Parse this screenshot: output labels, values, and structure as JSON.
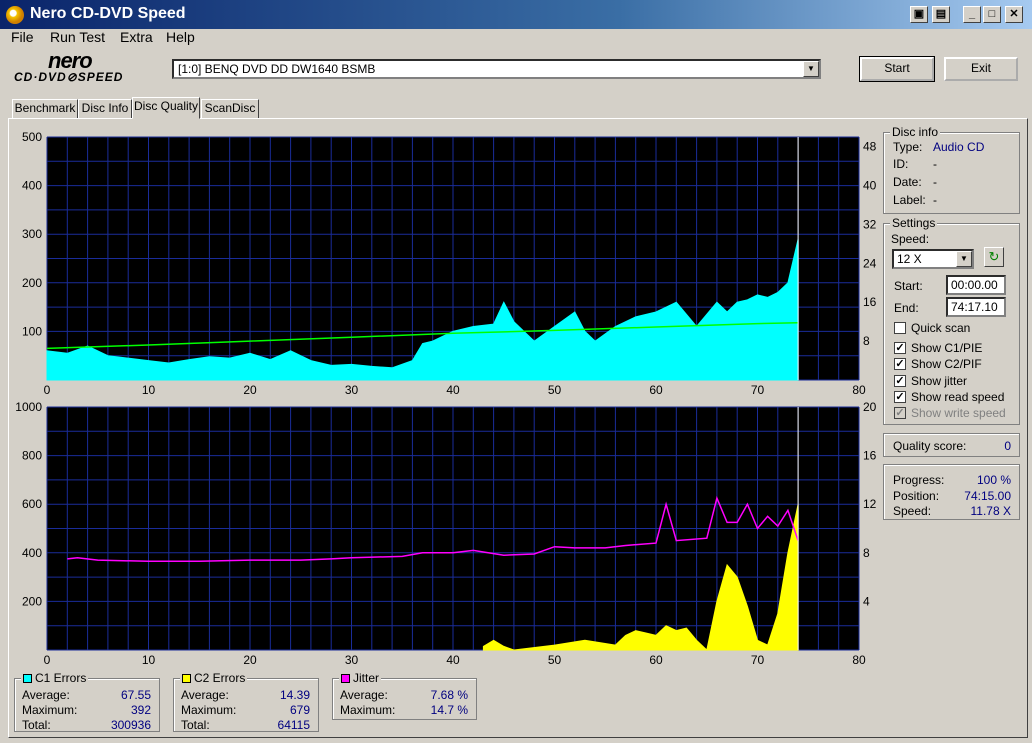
{
  "window": {
    "title": "Nero CD-DVD Speed"
  },
  "menu": {
    "file": "File",
    "run_test": "Run Test",
    "extra": "Extra",
    "help": "Help"
  },
  "logo": {
    "brand": "nero",
    "product": "CD·DVD⊘SPEED"
  },
  "drive": {
    "selected": "[1:0]  BENQ DVD DD DW1640 BSMB"
  },
  "buttons": {
    "start": "Start",
    "exit": "Exit"
  },
  "tabs": [
    "Benchmark",
    "Disc Info",
    "Disc Quality",
    "ScanDisc"
  ],
  "active_tab": "Disc Quality",
  "disc_info": {
    "title": "Disc info",
    "type_label": "Type:",
    "type_value": "Audio CD",
    "id_label": "ID:",
    "id_value": "-",
    "date_label": "Date:",
    "date_value": "-",
    "label_label": "Label:",
    "label_value": "-"
  },
  "settings": {
    "title": "Settings",
    "speed_label": "Speed:",
    "speed_value": "12 X",
    "start_label": "Start:",
    "start_value": "00:00.00",
    "end_label": "End:",
    "end_value": "74:17.10",
    "quick_scan": "Quick scan",
    "quick_scan_checked": false,
    "show_c1": "Show C1/PIE",
    "show_c1_checked": true,
    "show_c2": "Show C2/PIF",
    "show_c2_checked": true,
    "show_jitter": "Show jitter",
    "show_jitter_checked": true,
    "show_read": "Show read speed",
    "show_read_checked": true,
    "show_write": "Show write speed",
    "show_write_checked": true
  },
  "quality": {
    "label": "Quality score:",
    "value": "0"
  },
  "progress": {
    "progress_label": "Progress:",
    "progress_value": "100 %",
    "position_label": "Position:",
    "position_value": "74:15.00",
    "speed_label": "Speed:",
    "speed_value": "11.78 X"
  },
  "stats": {
    "c1": {
      "title": "C1 Errors",
      "color": "#00ffff",
      "avg_label": "Average:",
      "avg": "67.55",
      "max_label": "Maximum:",
      "max": "392",
      "total_label": "Total:",
      "total": "300936"
    },
    "c2": {
      "title": "C2 Errors",
      "color": "#ffff00",
      "avg_label": "Average:",
      "avg": "14.39",
      "max_label": "Maximum:",
      "max": "679",
      "total_label": "Total:",
      "total": "64115"
    },
    "jitter": {
      "title": "Jitter",
      "color": "#ff00ff",
      "avg_label": "Average:",
      "avg": "7.68 %",
      "max_label": "Maximum:",
      "max": "14.7 %"
    }
  },
  "chart_data": [
    {
      "type": "area",
      "x_ticks": [
        "0",
        "10",
        "20",
        "30",
        "40",
        "50",
        "60",
        "70",
        "80"
      ],
      "y_left_ticks": [
        "100",
        "200",
        "300",
        "400",
        "500"
      ],
      "y_right_ticks": [
        "8",
        "16",
        "24",
        "32",
        "40",
        "48"
      ],
      "xlim": [
        0,
        80
      ],
      "ylim_left": [
        0,
        500
      ],
      "ylim_right": [
        0,
        50
      ],
      "series": [
        {
          "color": "#00ffff",
          "x": [
            0,
            2,
            4,
            6,
            8,
            10,
            12,
            14,
            16,
            18,
            20,
            22,
            24,
            26,
            28,
            30,
            32,
            34,
            36,
            37,
            38,
            40,
            42,
            44,
            45,
            46,
            48,
            50,
            52,
            53,
            54,
            56,
            58,
            60,
            62,
            64,
            66,
            67,
            68,
            69,
            70,
            71,
            72,
            73,
            74
          ],
          "y": [
            60,
            55,
            70,
            50,
            45,
            40,
            35,
            42,
            48,
            45,
            55,
            42,
            60,
            40,
            30,
            32,
            28,
            25,
            40,
            75,
            80,
            100,
            110,
            115,
            160,
            120,
            80,
            110,
            140,
            100,
            80,
            110,
            130,
            140,
            160,
            110,
            160,
            140,
            160,
            165,
            175,
            170,
            180,
            200,
            290
          ]
        },
        {
          "color": "#00ff00",
          "x": [
            0,
            10,
            20,
            30,
            40,
            50,
            60,
            70,
            74
          ],
          "y": [
            6.5,
            7.2,
            8.0,
            8.8,
            9.6,
            10.2,
            10.9,
            11.6,
            11.8
          ]
        }
      ]
    },
    {
      "type": "area",
      "x_ticks": [
        "0",
        "10",
        "20",
        "30",
        "40",
        "50",
        "60",
        "70",
        "80"
      ],
      "y_left_ticks": [
        "200",
        "400",
        "600",
        "800",
        "1000"
      ],
      "y_right_ticks": [
        "4",
        "8",
        "12",
        "16",
        "20"
      ],
      "xlim": [
        0,
        80
      ],
      "ylim_left": [
        0,
        1000
      ],
      "ylim_right": [
        0,
        20
      ],
      "series": [
        {
          "color": "#ffff00",
          "x": [
            43,
            44,
            45,
            46,
            50,
            53,
            56,
            57,
            58,
            59,
            60,
            61,
            62,
            63,
            64,
            65,
            66,
            67,
            68,
            69,
            70,
            71,
            72,
            73,
            74
          ],
          "y": [
            15,
            40,
            15,
            0,
            20,
            40,
            20,
            60,
            80,
            70,
            60,
            100,
            80,
            90,
            40,
            0,
            200,
            350,
            300,
            180,
            40,
            20,
            150,
            400,
            600
          ]
        },
        {
          "color": "#ff00ff",
          "x": [
            2,
            3,
            5,
            10,
            15,
            20,
            25,
            28,
            30,
            35,
            37,
            40,
            42,
            45,
            48,
            50,
            52,
            55,
            57,
            60,
            61,
            62,
            65,
            66,
            67,
            68,
            69,
            70,
            71,
            72,
            73,
            74
          ],
          "y": [
            7.5,
            7.6,
            7.4,
            7.3,
            7.3,
            7.4,
            7.4,
            7.5,
            7.6,
            7.7,
            8.0,
            8.0,
            8.2,
            7.8,
            7.9,
            8.5,
            8.4,
            8.4,
            8.6,
            8.8,
            12.0,
            9.0,
            9.2,
            12.5,
            10.5,
            10.5,
            12.0,
            10.0,
            11.0,
            10.2,
            11.5,
            9.0
          ]
        }
      ]
    }
  ]
}
